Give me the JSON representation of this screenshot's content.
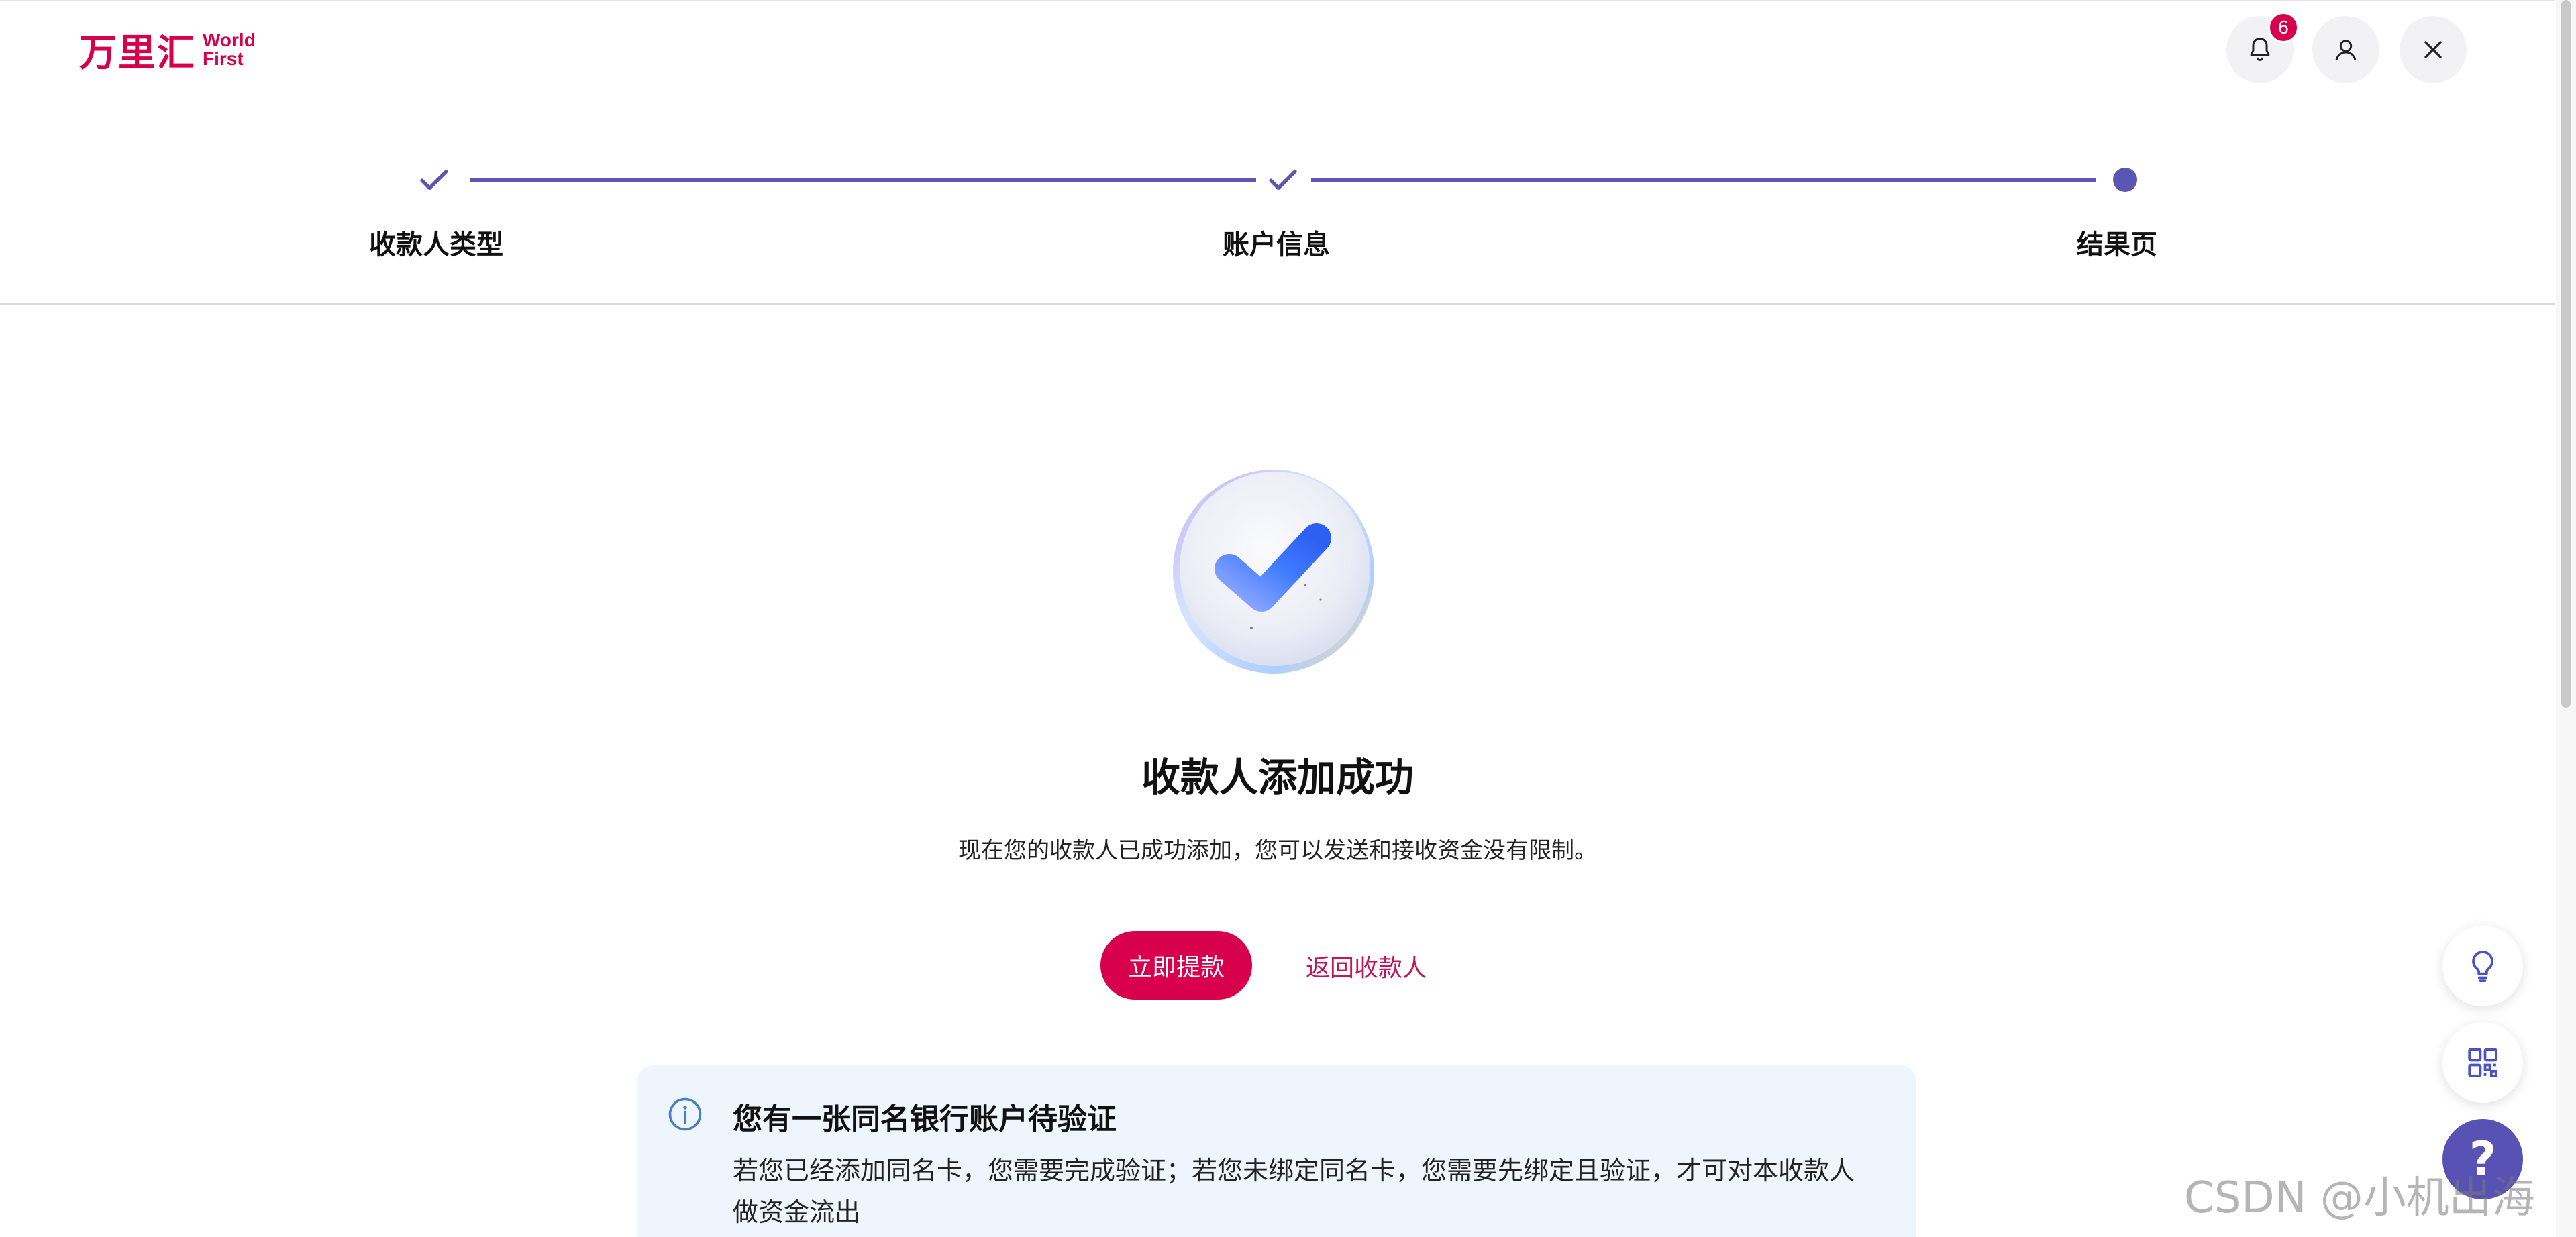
{
  "header": {
    "logo_cn": "万里汇",
    "logo_en_line1": "World",
    "logo_en_line2": "First",
    "notification_count": "6"
  },
  "stepper": {
    "steps": [
      {
        "label": "收款人类型",
        "status": "done"
      },
      {
        "label": "账户信息",
        "status": "done"
      },
      {
        "label": "结果页",
        "status": "current"
      }
    ]
  },
  "result": {
    "title": "收款人添加成功",
    "description": "现在您的收款人已成功添加，您可以发送和接收资金没有限制。",
    "primary_button": "立即提款",
    "secondary_link": "返回收款人"
  },
  "info_panel": {
    "title": "您有一张同名银行账户待验证",
    "body": "若您已经添加同名卡，您需要完成验证；若您未绑定同名卡，您需要先绑定且验证，才可对本收款人做资金流出"
  },
  "floating": {
    "help_label": "?"
  },
  "watermark": "CSDN @小机出海",
  "colors": {
    "brand": "#d8004a",
    "accent": "#5b55b4",
    "info_bg": "#eef5fd"
  }
}
